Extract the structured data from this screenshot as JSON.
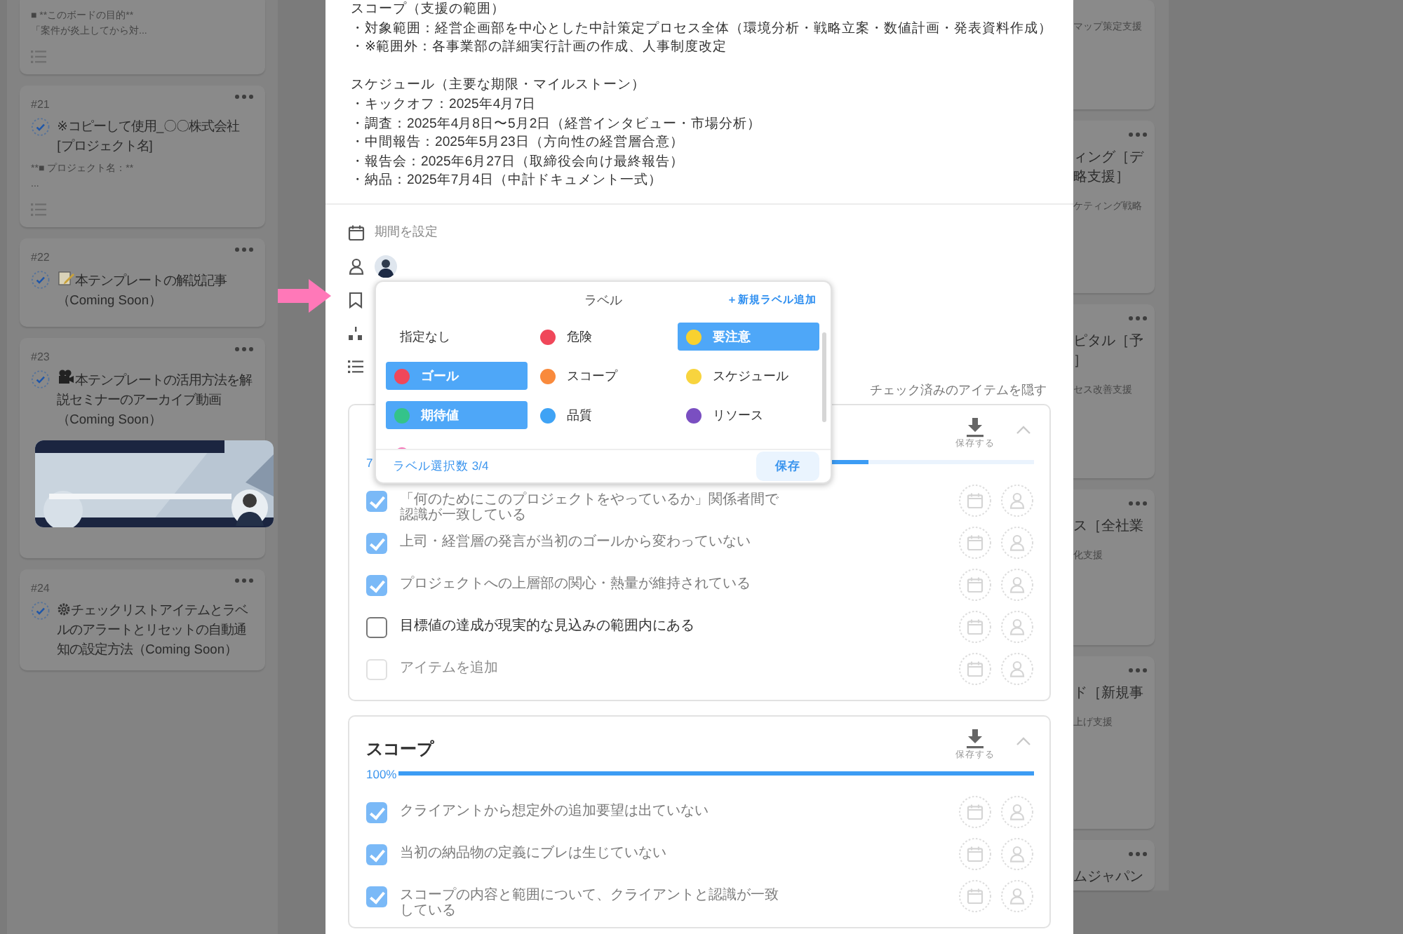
{
  "left_column": {
    "cards": [
      {
        "lines": [
          "■ **このボードの目的**",
          "「案件が炎上してから対..."
        ],
        "has_description": true
      },
      {
        "number": "#21",
        "done": true,
        "title": "※コピーして使用_〇〇株式会社[プロジェクト名]",
        "lines": [
          "**■ プロジェクト名：**",
          "..."
        ],
        "has_description": true
      },
      {
        "number": "#22",
        "done": true,
        "kind": "memo",
        "title": "本テンプレートの解説記事（Coming Soon）"
      },
      {
        "number": "#23",
        "done": true,
        "kind": "video",
        "title": "本テンプレートの活用方法を解説セミナーのアーカイブ動画（Coming Soon）"
      },
      {
        "number": "#24",
        "done": true,
        "kind": "gear",
        "title": "チェックリストアイテムとラベルのアラートとリセットの自動通知の設定方法（Coming Soon）"
      }
    ]
  },
  "detail": {
    "description": [
      [
        "スコープ（支援の範囲）",
        "・対象範囲：経営企画部を中心とした中計策定プロセス全体（環境分析・戦略立案・数値計画・発表資料作成）",
        "・※範囲外：各事業部の詳細実行計画の作成、人事制度改定"
      ],
      [
        "スケジュール（主要な期限・マイルストーン）",
        "・キックオフ：2025年4月7日",
        "・調査：2025年4月8日〜5月2日（経営インタビュー・市場分析）",
        "・中間報告：2025年5月23日（方向性の経営層合意）",
        "・報告会：2025年6月27日（取締役会向け最終報告）",
        "・納品：2025年7月4日（中計ドキュメント一式）"
      ]
    ],
    "period_placeholder": "期間を設定",
    "hide_checked": "チェック済みのアイテムを隠す",
    "label_popup": {
      "title": "ラベル",
      "add_link": "＋新規ラベル追加",
      "count": "ラベル選択数 3/4",
      "save": "保存",
      "labels": [
        {
          "name": "指定なし",
          "selected": false
        },
        {
          "name": "危険",
          "color": "#f0475a",
          "selected": false
        },
        {
          "name": "要注意",
          "color": "#f8d12f",
          "selected": true
        },
        {
          "name": "ゴール",
          "color": "#f0475a",
          "selected": true
        },
        {
          "name": "スコープ",
          "color": "#f98a3c",
          "selected": false
        },
        {
          "name": "スケジュール",
          "color": "#f8d43e",
          "selected": false
        },
        {
          "name": "期待値",
          "color": "#34c38a",
          "selected": true
        },
        {
          "name": "品質",
          "color": "#3fa3f5",
          "selected": false
        },
        {
          "name": "リソース",
          "color": "#7a4fc1",
          "selected": false
        },
        {
          "color": "#f36fb4",
          "selected": false
        }
      ]
    },
    "checklists": [
      {
        "progress": "7",
        "level": 0.75,
        "save_label": "保存する",
        "expanded": true,
        "add_placeholder": "アイテムを追加",
        "items": [
          {
            "text": "「何のためにこのプロジェクトをやっているか」関係者間で認識が一致している",
            "checked": true
          },
          {
            "text": "上司・経営層の発言が当初のゴールから変わっていない",
            "checked": true
          },
          {
            "text": "プロジェクトへの上層部の関心・熱量が維持されている",
            "checked": true
          },
          {
            "text": "目標値の達成が現実的な見込みの範囲内にある",
            "checked": false
          }
        ]
      },
      {
        "title": "スコープ",
        "progress": "100%",
        "level": 1,
        "save_label": "保存する",
        "expanded": true,
        "items": [
          {
            "text": "クライアントから想定外の追加要望は出ていない",
            "checked": true
          },
          {
            "text": "当初の納品物の定義にブレは生じていない",
            "checked": true
          },
          {
            "text": "スコープの内容と範囲について、クライアントと認識が一致している",
            "checked": true
          }
        ]
      }
    ]
  },
  "right_column": {
    "cards": [
      {
        "note": "マップ策定支援"
      },
      {
        "title_lines": [
          "ィング［デ",
          "略支援］"
        ],
        "note": "ケティング戦略"
      },
      {
        "title_lines": [
          "ピタル［予",
          "］"
        ],
        "note": "セス改善支援"
      },
      {
        "title_lines": [
          "ス［全社業"
        ],
        "note": "化支援"
      },
      {
        "title_lines": [
          "ド［新規事"
        ],
        "note": "上げ支援"
      },
      {
        "title_lines": [
          "ムジャパン"
        ]
      }
    ]
  }
}
